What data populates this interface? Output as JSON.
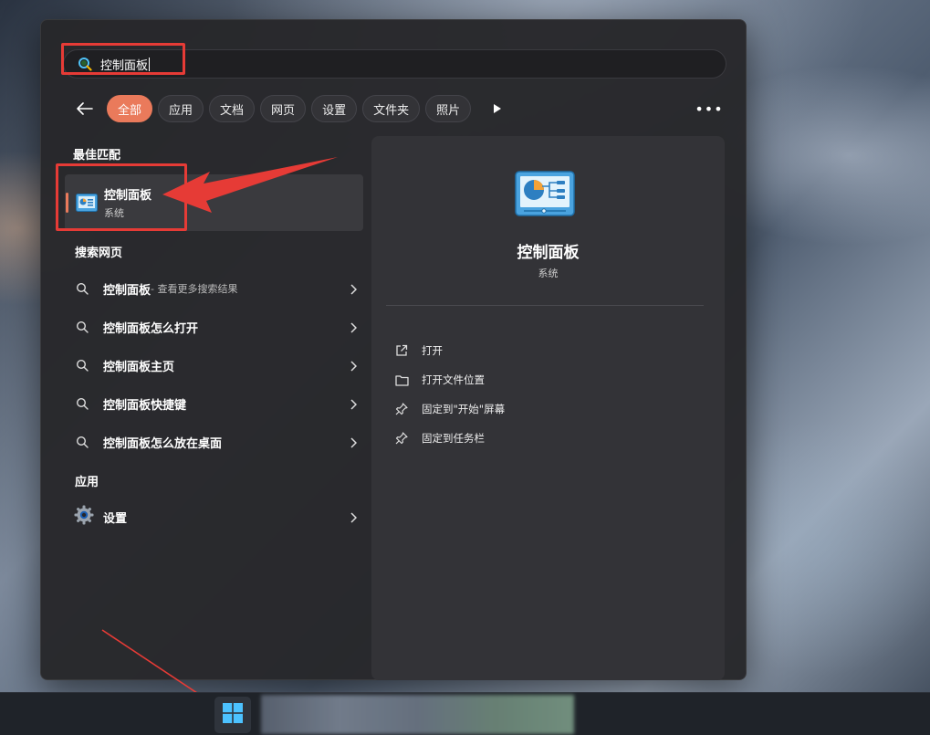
{
  "search": {
    "query": "控制面板"
  },
  "filters": {
    "items": [
      "全部",
      "应用",
      "文档",
      "网页",
      "设置",
      "文件夹",
      "照片"
    ],
    "active_index": 0
  },
  "sections": {
    "best_match": "最佳匹配",
    "web": "搜索网页",
    "apps": "应用"
  },
  "best_match": {
    "name": "控制面板",
    "subtitle": "系统"
  },
  "web_results": [
    {
      "text": "控制面板",
      "hint": " - 查看更多搜索结果"
    },
    {
      "text": "控制面板怎么打开",
      "hint": ""
    },
    {
      "text": "控制面板主页",
      "hint": ""
    },
    {
      "text": "控制面板快捷键",
      "hint": ""
    },
    {
      "text": "控制面板怎么放在桌面",
      "hint": ""
    }
  ],
  "apps": [
    {
      "name": "设置",
      "icon": "gear-icon"
    }
  ],
  "preview": {
    "title": "控制面板",
    "subtitle": "系统",
    "actions": [
      {
        "label": "打开",
        "icon": "open-external-icon"
      },
      {
        "label": "打开文件位置",
        "icon": "folder-icon"
      },
      {
        "label": "固定到\"开始\"屏幕",
        "icon": "pin-icon"
      },
      {
        "label": "固定到任务栏",
        "icon": "pin-icon"
      }
    ]
  },
  "colors": {
    "accent": "#ea7a5b",
    "annotation": "#e63b36",
    "panel": "#27272a"
  }
}
